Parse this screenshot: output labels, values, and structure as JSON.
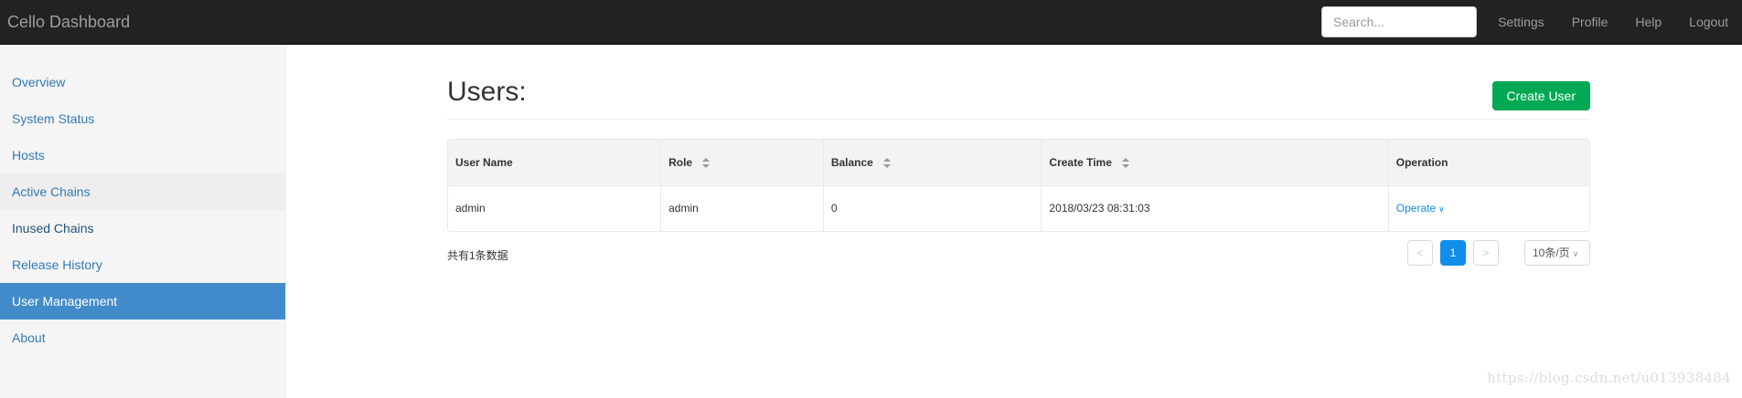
{
  "navbar": {
    "brand": "Cello Dashboard",
    "search_placeholder": "Search...",
    "links": [
      "Settings",
      "Profile",
      "Help",
      "Logout"
    ]
  },
  "sidebar": {
    "items": [
      {
        "label": "Overview"
      },
      {
        "label": "System Status"
      },
      {
        "label": "Hosts"
      },
      {
        "label": "Active Chains"
      },
      {
        "label": "Inused Chains"
      },
      {
        "label": "Release History"
      },
      {
        "label": "User Management"
      },
      {
        "label": "About"
      }
    ],
    "active": "User Management"
  },
  "main": {
    "title": "Users:",
    "create_button": "Create User",
    "table": {
      "columns": [
        "User Name",
        "Role",
        "Balance",
        "Create Time",
        "Operation"
      ],
      "rows": [
        {
          "user_name": "admin",
          "role": "admin",
          "balance": "0",
          "create_time": "2018/03/23 08:31:03",
          "operation": "Operate"
        }
      ]
    },
    "footer": {
      "total": "共有1条数据",
      "prev": "<",
      "current_page": "1",
      "next": ">",
      "page_size": "10条/页"
    }
  },
  "watermark": "https://blog.csdn.net/u013938484",
  "colors": {
    "navbar": "#222222",
    "sidebar_active": "#428bca",
    "create_button": "#00a854",
    "pager_active": "#108ee9"
  }
}
